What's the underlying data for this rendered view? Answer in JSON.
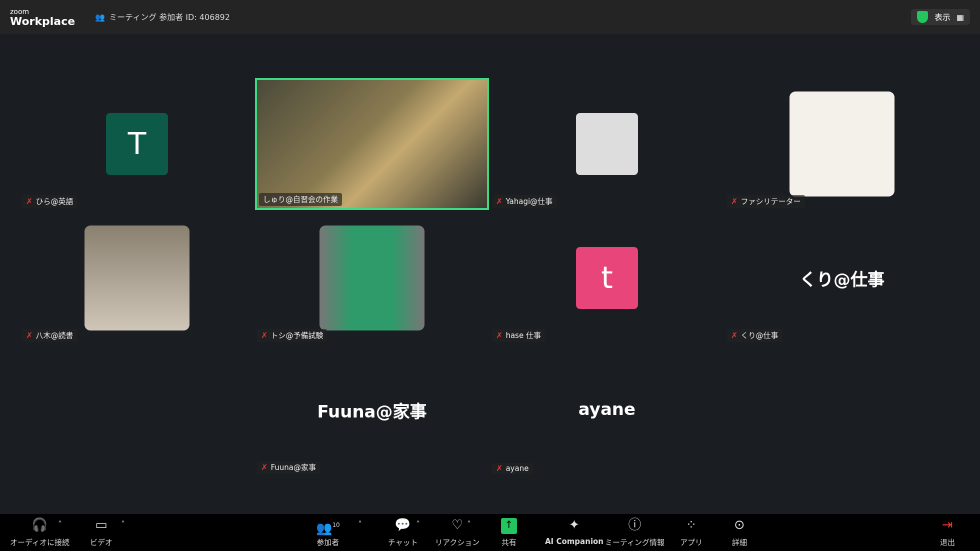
{
  "header": {
    "logo_small": "zoom",
    "logo_main": "Workplace",
    "meeting_label": "ミーティング 参加者 ID: 406892",
    "view_label": "表示"
  },
  "tiles": [
    {
      "name": "ひら@英語",
      "initial": "T",
      "color": "#0e5a48"
    },
    {
      "name": "しゅり@自習会の作業"
    },
    {
      "name": "Yahagi@仕事"
    },
    {
      "name": "ファシリテーター"
    },
    {
      "name": "八木@読書"
    },
    {
      "name": "トシ@予備試験"
    },
    {
      "name": "hase 仕事",
      "initial": "t",
      "color": "#e8457a"
    },
    {
      "name": "くり@仕事",
      "display": "くり@仕事"
    },
    {
      "name": "Fuuna@家事",
      "display": "Fuuna@家事"
    },
    {
      "name": "ayane",
      "display": "ayane"
    }
  ],
  "toolbar": {
    "audio": "オーディオに接続",
    "video": "ビデオ",
    "participants": "参加者",
    "participants_count": "10",
    "chat": "チャット",
    "reactions": "リアクション",
    "share": "共有",
    "ai": "AI Companion",
    "info": "ミーティング情報",
    "apps": "アプリ",
    "more": "詳細",
    "leave": "退出"
  }
}
